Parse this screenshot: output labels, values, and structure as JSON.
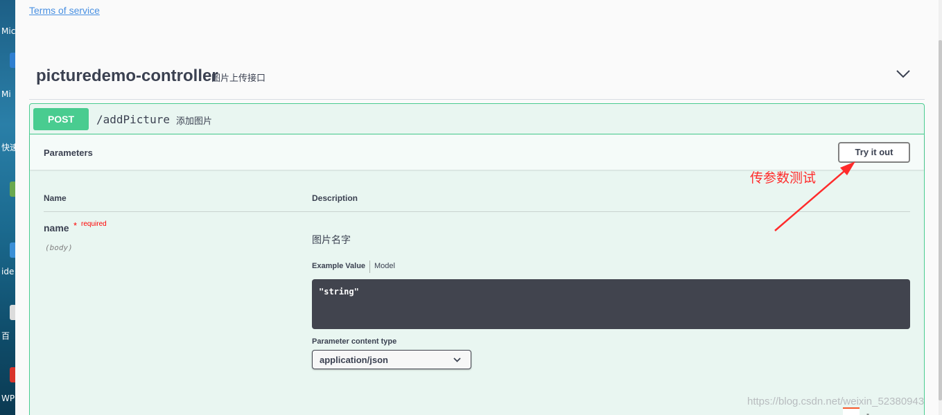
{
  "desktop": {
    "icon_labels": [
      "Mic",
      "Mi",
      "快速",
      "ide",
      "百",
      "WP"
    ]
  },
  "info": {
    "terms_link": "Terms of service"
  },
  "tag": {
    "name": "picturedemo-controller",
    "description": "图片上传接口"
  },
  "operation": {
    "method": "POST",
    "path": "/addPicture",
    "summary": "添加图片",
    "parameters_title": "Parameters",
    "try_button": "Try it out",
    "columns": {
      "name": "Name",
      "description": "Description"
    },
    "param": {
      "name": "name",
      "required_star": "*",
      "required_label": "required",
      "location": "(body)",
      "description": "图片名字",
      "example_tab": "Example Value",
      "model_tab": "Model",
      "example_code": "\"string\"",
      "content_type_label": "Parameter content type",
      "content_type_value": "application/json"
    }
  },
  "annotation": {
    "text": "传参数测试",
    "color": "#ff2b2b"
  },
  "watermark": "https://blog.csdn.net/weixin_52380943",
  "colors": {
    "post": "#49cc90",
    "post_bg": "#e9f6f1",
    "link": "#4990e2",
    "code_bg": "#41444e"
  }
}
